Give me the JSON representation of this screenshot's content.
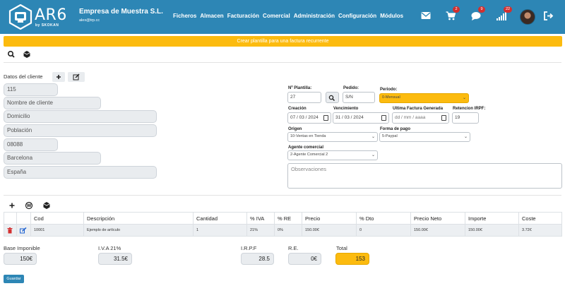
{
  "header": {
    "logo_text": "AR6",
    "logo_sub": "by SKOKAN",
    "company": "Empresa de Muestra S.L.",
    "email": "alex@trp.cc",
    "nav": [
      "Ficheros",
      "Almacen",
      "Facturación",
      "Comercial",
      "Administración",
      "Configuración",
      "Módulos"
    ],
    "badges": {
      "cart": "2",
      "chat": "9",
      "signal": "22"
    }
  },
  "banner": "Crear plantilla para una factura recurrente",
  "client": {
    "section_label": "Datos del cliente",
    "code": "115",
    "name_placeholder": "Nombre de cliente",
    "address_placeholder": "Domicilio",
    "city_placeholder": "Población",
    "zip": "08088",
    "province": "Barcelona",
    "country": "España"
  },
  "form": {
    "plantilla_label": "Nº Plantilla:",
    "plantilla_value": "27",
    "pedido_label": "Pedido:",
    "pedido_value": "S/N",
    "periodo_label": "Periodo:",
    "periodo_value": "0-Mensual",
    "creacion_label": "Creación",
    "creacion_value": "07 / 03 / 2024",
    "vencimiento_label": "Vencimiento",
    "vencimiento_value": "31 / 03 / 2024",
    "ultima_label": "Ultima Factura Generada",
    "ultima_value": "dd / mm / aaaa",
    "retencion_label": "Retencion IRPF:",
    "retencion_value": "19",
    "origen_label": "Origen",
    "origen_value": "10-Ventas en Tienda",
    "pago_label": "Forma de pago",
    "pago_value": "5-Paypal",
    "agente_label": "Agente comercial",
    "agente_value": "2-Agente Comercial 2",
    "observaciones_placeholder": "Observaciones"
  },
  "table": {
    "headers": [
      "",
      "",
      "Cod",
      "Descripción",
      "Cantidad",
      "% IVA",
      "% RE",
      "Precio",
      "% Dto",
      "Precio Neto",
      "Importe",
      "Coste"
    ],
    "rows": [
      [
        "",
        "",
        "10001",
        "Ejemplo de artículo",
        "1",
        "21%",
        "0%",
        "150.00€",
        "0",
        "150.00€",
        "150.00€",
        "3.72€"
      ]
    ]
  },
  "totals": {
    "base_label": "Base Imponible",
    "base_value": "150€",
    "iva_label": "I.V.A 21%",
    "iva_value": "31.5€",
    "irpf_label": "I.R.P.F",
    "irpf_value": "28.5",
    "re_label": "R.E.",
    "re_value": "0€",
    "total_label": "Total",
    "total_value": "153"
  },
  "save_label": "Guardar",
  "colors": {
    "primary": "#2d86b5",
    "accent": "#fcbb0f",
    "badge": "#d32f2f"
  }
}
